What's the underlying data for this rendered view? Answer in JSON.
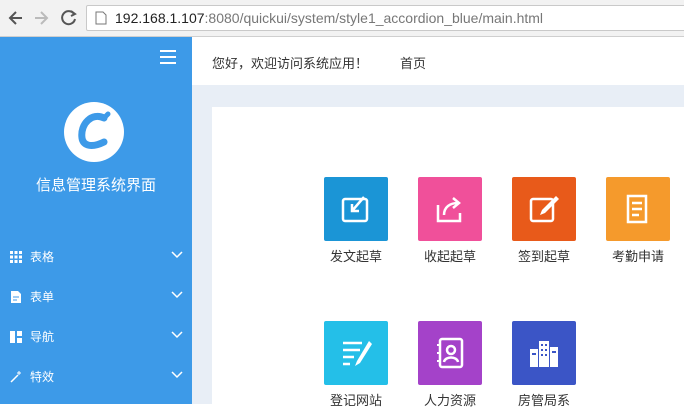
{
  "browser": {
    "url_host": "192.168.1.107",
    "url_rest": ":8080/quickui/system/style1_accordion_blue/main.html"
  },
  "sidebar": {
    "title": "信息管理系统界面",
    "items": [
      {
        "label": "表格",
        "icon": "grid-icon"
      },
      {
        "label": "表单",
        "icon": "form-icon"
      },
      {
        "label": "导航",
        "icon": "layout-icon"
      },
      {
        "label": "特效",
        "icon": "magic-icon"
      }
    ]
  },
  "topbar": {
    "greeting": "您好，欢迎访问系统应用！",
    "home": "首页"
  },
  "tiles": [
    {
      "label": "发文起草",
      "color": "#1b95d6",
      "icon": "send-draft-icon"
    },
    {
      "label": "收起起草",
      "color": "#f0509a",
      "icon": "share-icon"
    },
    {
      "label": "签到起草",
      "color": "#e85a1a",
      "icon": "edit-icon"
    },
    {
      "label": "考勤申请",
      "color": "#f59a2c",
      "icon": "document-icon"
    },
    {
      "label": "登记网站",
      "color": "#24bfe8",
      "icon": "register-icon"
    },
    {
      "label": "人力资源",
      "color": "#a442c9",
      "icon": "contacts-icon"
    },
    {
      "label": "房管局系",
      "color": "#3b55c6",
      "icon": "buildings-icon"
    }
  ]
}
